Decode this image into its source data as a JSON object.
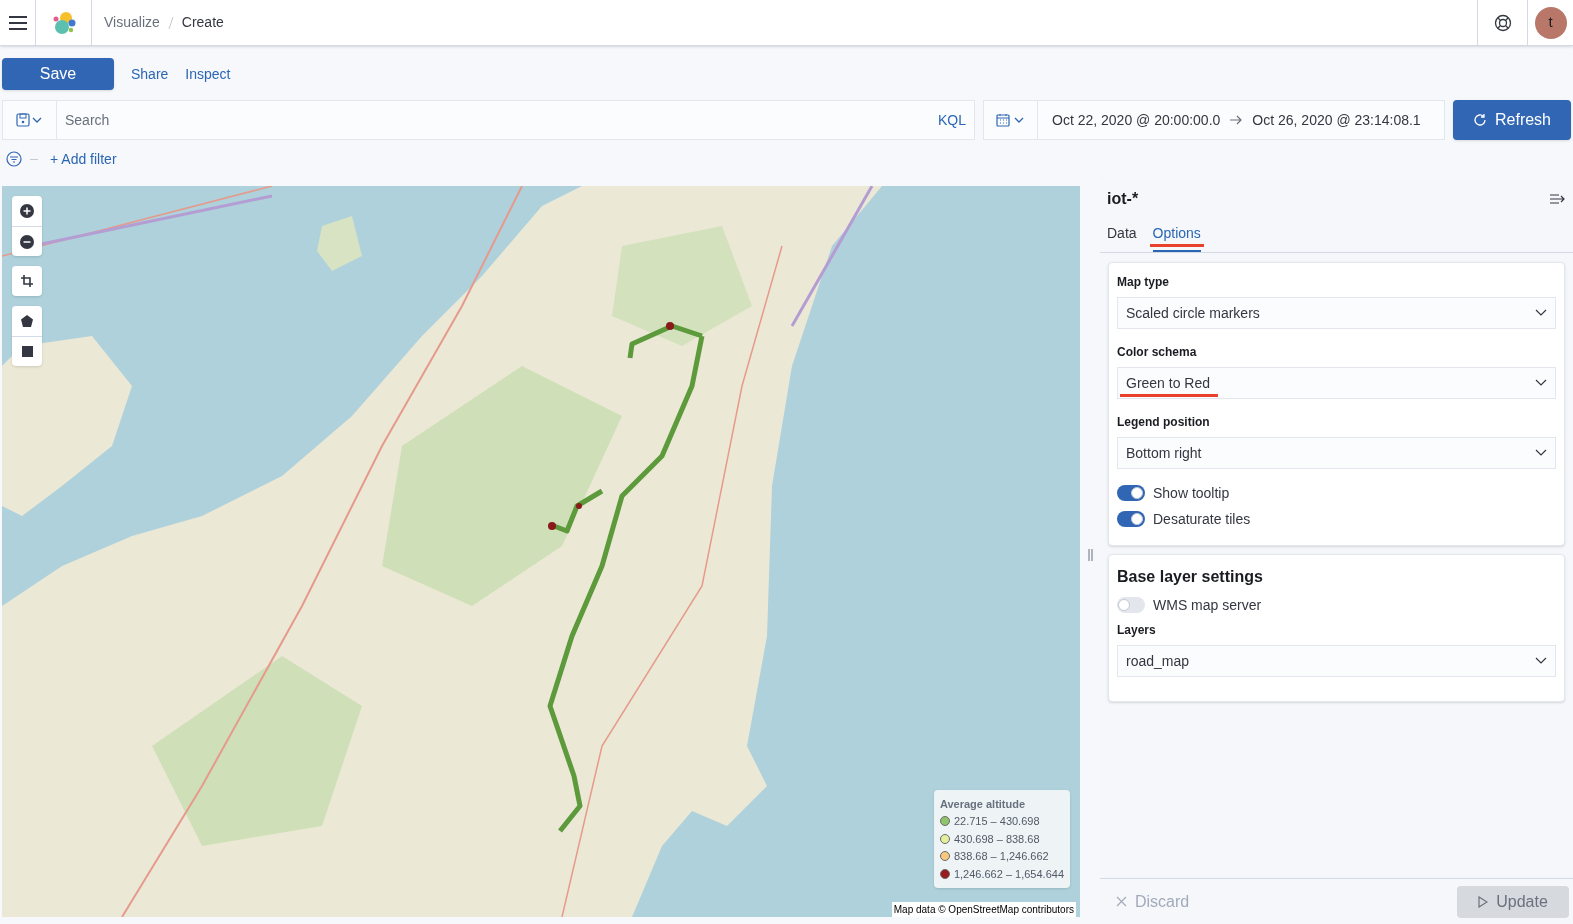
{
  "header": {
    "breadcrumbs": [
      {
        "label": "Visualize",
        "current": false
      },
      {
        "label": "Create",
        "current": true
      }
    ],
    "avatar": "t"
  },
  "toolbar": {
    "save": "Save",
    "links": [
      "Share",
      "Inspect"
    ]
  },
  "query": {
    "placeholder": "Search",
    "language": "KQL",
    "start": "Oct 22, 2020 @ 20:00:00.0",
    "end": "Oct 26, 2020 @ 23:14:08.1",
    "refresh": "Refresh"
  },
  "filter": {
    "add": "+ Add filter"
  },
  "map": {
    "legend": {
      "title": "Average altitude",
      "items": [
        {
          "label": "22.715 – 430.698",
          "color": "#8fc46b"
        },
        {
          "label": "430.698 – 838.68",
          "color": "#e3ee9e"
        },
        {
          "label": "838.68 – 1,246.662",
          "color": "#f7c97c"
        },
        {
          "label": "1,246.662 – 1,654.644",
          "color": "#9b1c1c"
        }
      ]
    },
    "attribution": "Map data © OpenStreetMap contributors"
  },
  "editor": {
    "title": "iot-*",
    "tabs": [
      {
        "label": "Data",
        "selected": false,
        "marked": false
      },
      {
        "label": "Options",
        "selected": true,
        "marked": true
      }
    ],
    "sections": [
      {
        "fields": [
          {
            "kind": "select",
            "label": "Map type",
            "value": "Scaled circle markers",
            "marked": false
          },
          {
            "kind": "select",
            "label": "Color schema",
            "value": "Green to Red",
            "marked": true
          },
          {
            "kind": "select",
            "label": "Legend position",
            "value": "Bottom right",
            "marked": false
          },
          {
            "kind": "switch",
            "label": "Show tooltip",
            "on": true
          },
          {
            "kind": "switch",
            "label": "Desaturate tiles",
            "on": true
          }
        ]
      },
      {
        "title": "Base layer settings",
        "fields": [
          {
            "kind": "switch",
            "label": "WMS map server",
            "on": false
          },
          {
            "kind": "select",
            "label": "Layers",
            "value": "road_map",
            "marked": false
          }
        ]
      }
    ]
  },
  "footer": {
    "discard": "Discard",
    "update": "Update",
    "update_disabled": true
  }
}
